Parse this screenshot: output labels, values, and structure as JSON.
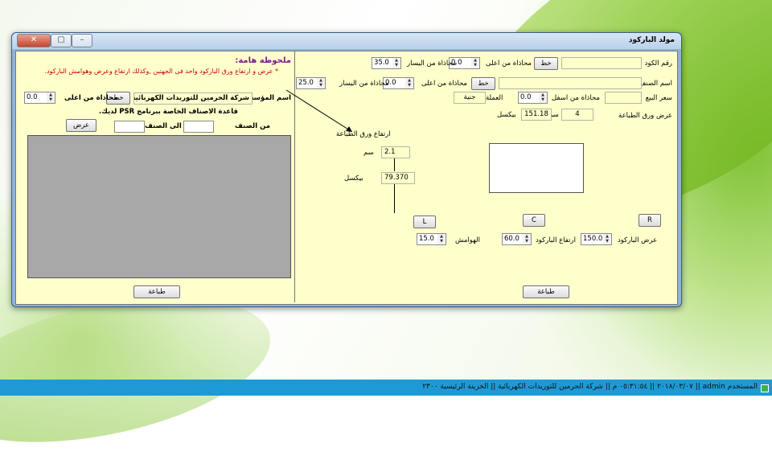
{
  "window": {
    "title": "مولد الباركود"
  },
  "taskbar": {
    "status": "المستخدم  admin  ||  ٢٠١٨/٠٣/٠٧  ||  ٠٥:٣١:٥٤ م  ||  شركة الحرمين للتوريدات الكهربائية  ||  الخزينة الرئيسية  ٢٣٠٠"
  },
  "right": {
    "code_label": "رقم الكود",
    "code_value": "",
    "font_btn_1": "خط",
    "align_top_label_1": "محاذاة من اعلى",
    "align_top_value_1": "0.0",
    "align_left_label_1": "محاذاة من اليسار",
    "align_left_value_1": "35.0",
    "item_label": "اسم الصنف",
    "item_value": "",
    "font_btn_2": "خط",
    "align_top_label_2": "محاذاة من اعلى",
    "align_top_value_2": "0.0",
    "align_left_label_2": "محاذاة من اليسار",
    "align_left_value_2": "25.0",
    "price_label": "سعر البيع",
    "price_value": "",
    "align_bottom_label": "محاذاة من اسفل",
    "align_bottom_value": "0.0",
    "currency_label": "العملة",
    "currency_value": "جنية",
    "paper_width_label": "عرض ورق الطباعة",
    "paper_width_value": "4",
    "cm_label": "سم",
    "paper_width_px": "151.18",
    "pixel_label": "بيكسل",
    "paper_height_label": "ارتفاع ورق الطباعة",
    "paper_height_value": "2.1",
    "cm_label_2": "سم",
    "paper_height_px": "79.370",
    "pixel_label_2": "بيكسل",
    "align_l": "L",
    "align_c": "C",
    "align_r": "R",
    "barcode_width_label": "عرض الباركود",
    "barcode_width_value": "150.0",
    "barcode_height_label": "ارتفاع الباركود",
    "barcode_height_value": "60.0",
    "margins_label": "الهوامش",
    "margins_value": "15.0",
    "print_btn": "طباعة"
  },
  "left": {
    "note_title": "ملحوظة هامة:",
    "note_text": "* عرض و ارتفاع ورق الباركود واحد فى الجهتين ,وكذلك ارتفاع وعرض وهوامش الباركود.",
    "company_label": "اسم المؤسسة",
    "company_value": "شركة الحرمين للتوريدات الكهربائية",
    "font_btn": "خط",
    "align_top_label": "محاذاة من اعلى",
    "align_top_value": "0.0",
    "db_title": "قاعدة الاصناف الخاصة ببرنامج PSR لديك.",
    "from_item_label": "من الصنف",
    "from_item_value": "",
    "to_item_label": "الى الصنف",
    "to_item_value": "",
    "show_btn": "عرض",
    "print_btn": "طباعة"
  },
  "colors": {
    "panel": "#ffffcc",
    "note_title": "#7a1a8c",
    "note_text": "#cc0000",
    "taskbar": "#1d9ad6"
  }
}
